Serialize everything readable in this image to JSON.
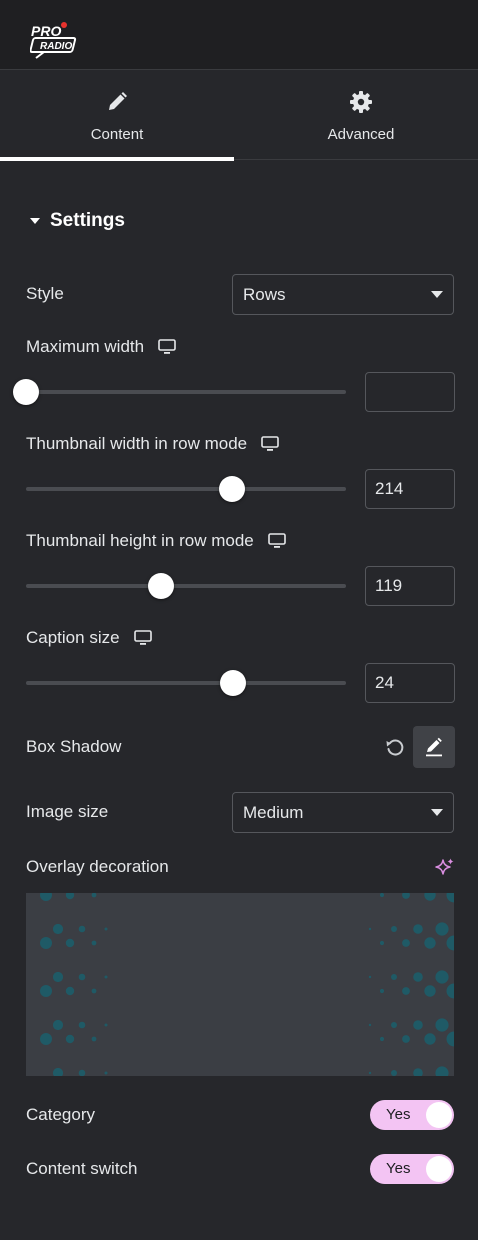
{
  "header": {
    "logo_alt": "PRO RADIO"
  },
  "tabs": [
    {
      "label": "Content",
      "icon": "pencil-icon",
      "active": true
    },
    {
      "label": "Advanced",
      "icon": "gear-icon",
      "active": false
    }
  ],
  "section": {
    "title": "Settings"
  },
  "controls": {
    "style": {
      "label": "Style",
      "value": "Rows"
    },
    "max_width": {
      "label": "Maximum width",
      "value": "",
      "slider_fraction": 0.0
    },
    "thumb_width": {
      "label": "Thumbnail width in row mode",
      "value": "214",
      "slider_fraction": 0.643
    },
    "thumb_height": {
      "label": "Thumbnail height in row mode",
      "value": "119",
      "slider_fraction": 0.422
    },
    "caption_size": {
      "label": "Caption size",
      "value": "24",
      "slider_fraction": 0.647
    },
    "box_shadow": {
      "label": "Box Shadow"
    },
    "image_size": {
      "label": "Image size",
      "value": "Medium"
    },
    "overlay": {
      "label": "Overlay decoration"
    },
    "category": {
      "label": "Category",
      "toggle": "Yes"
    },
    "content_switch": {
      "label": "Content switch",
      "toggle": "Yes"
    }
  },
  "colors": {
    "background": "#26272b",
    "toggle_on": "#f3c4f3",
    "dots": "#1f5a66",
    "sparkle": "#d98ee0"
  }
}
